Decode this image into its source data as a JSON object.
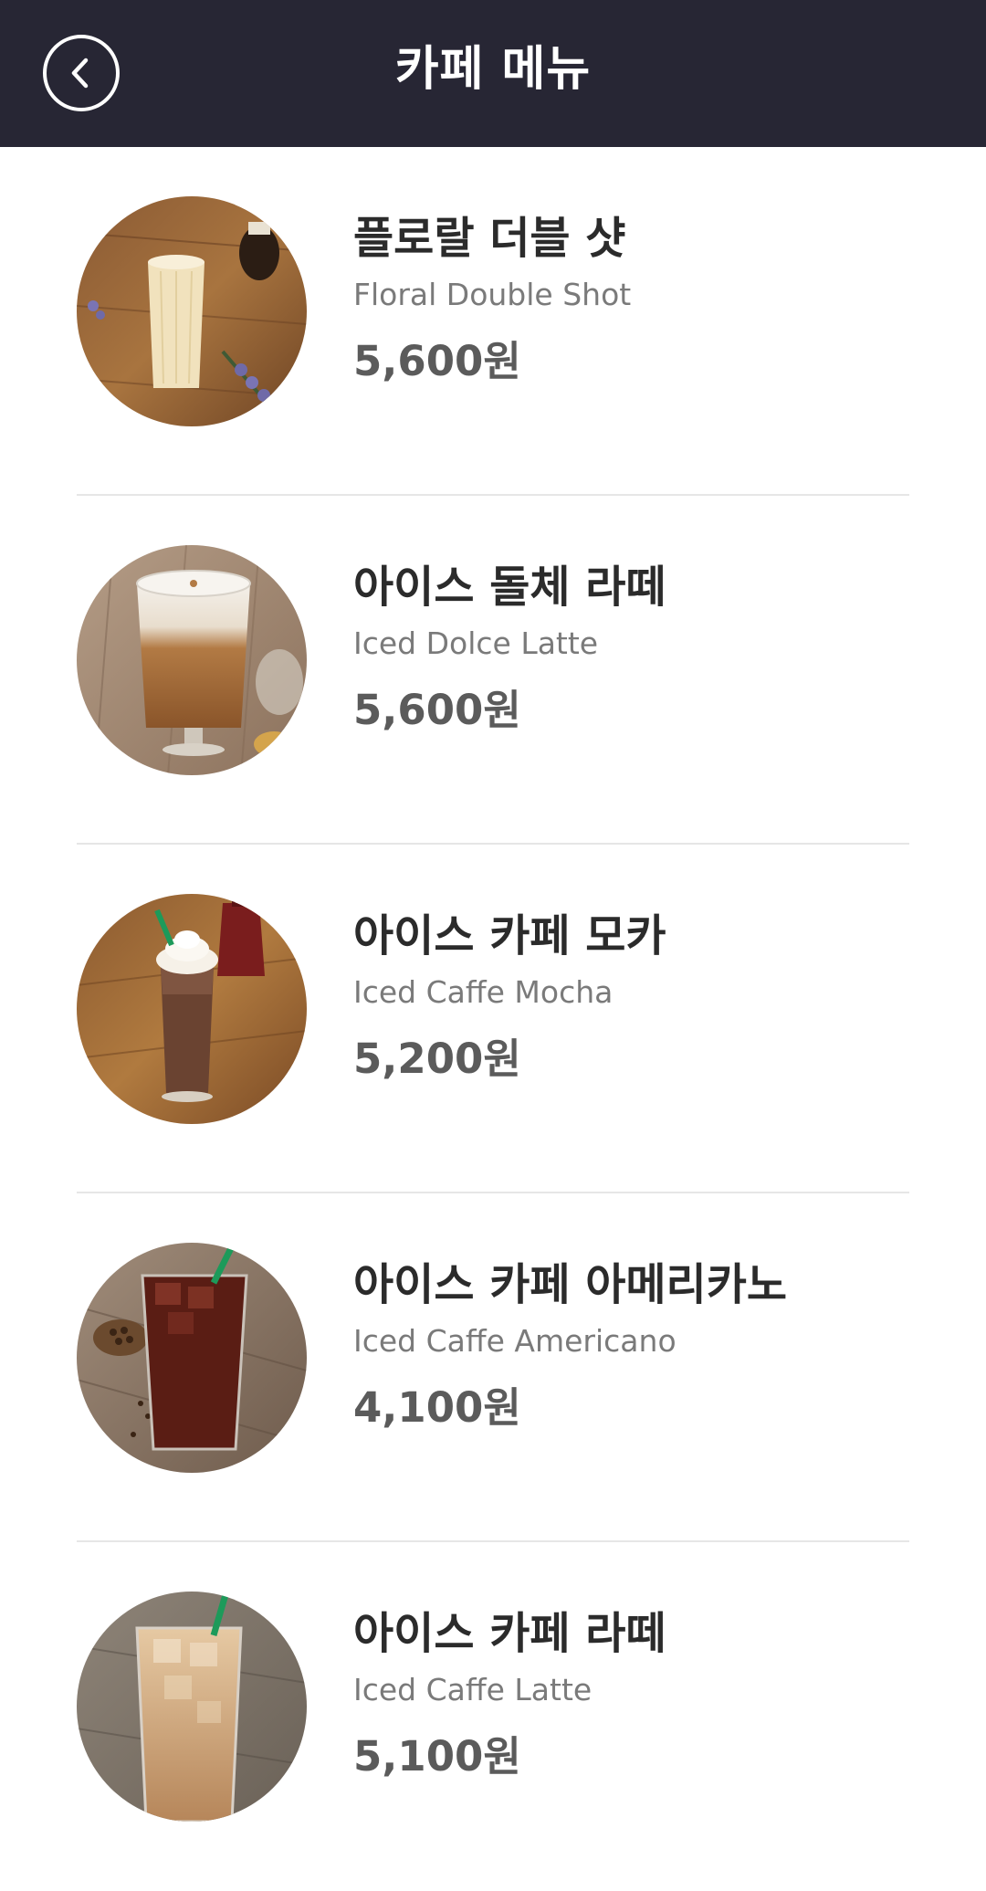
{
  "header": {
    "title": "카페 메뉴",
    "back_icon": "chevron-left-icon",
    "background": "#272634"
  },
  "menu": {
    "items": [
      {
        "name_ko": "플로랄 더블 샷",
        "name_en": "Floral Double Shot",
        "price": "5,600원",
        "image": "floral-double-shot-photo"
      },
      {
        "name_ko": "아이스 돌체 라떼",
        "name_en": "Iced Dolce Latte",
        "price": "5,600원",
        "image": "iced-dolce-latte-photo"
      },
      {
        "name_ko": "아이스 카페 모카",
        "name_en": "Iced Caffe Mocha",
        "price": "5,200원",
        "image": "iced-caffe-mocha-photo"
      },
      {
        "name_ko": "아이스 카페 아메리카노",
        "name_en": "Iced Caffe Americano",
        "price": "4,100원",
        "image": "iced-caffe-americano-photo"
      },
      {
        "name_ko": "아이스 카페 라떼",
        "name_en": "Iced Caffe Latte",
        "price": "5,100원",
        "image": "iced-caffe-latte-photo"
      }
    ]
  }
}
